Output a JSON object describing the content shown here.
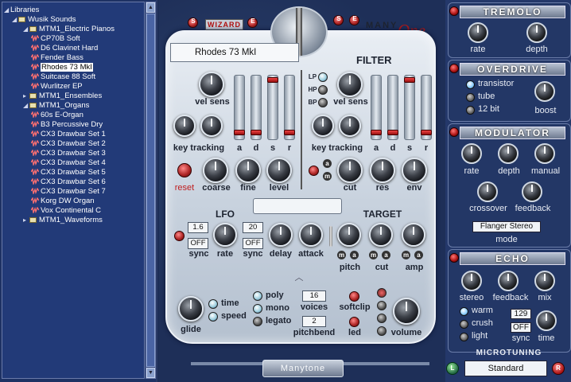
{
  "browser": {
    "items": [
      {
        "label": "Libraries",
        "level": 0,
        "type": "root"
      },
      {
        "label": "Wusik Sounds",
        "level": 1,
        "type": "folder"
      },
      {
        "label": "MTM1_Electric Pianos",
        "level": 2,
        "type": "folder"
      },
      {
        "label": "CP70B Soft",
        "level": 3,
        "type": "patch"
      },
      {
        "label": "D6 Clavinet Hard",
        "level": 3,
        "type": "patch"
      },
      {
        "label": "Fender Bass",
        "level": 3,
        "type": "patch"
      },
      {
        "label": "Rhodes 73 MkI",
        "level": 3,
        "type": "patch",
        "selected": true
      },
      {
        "label": "Suitcase 88 Soft",
        "level": 3,
        "type": "patch"
      },
      {
        "label": "Wurlitzer EP",
        "level": 3,
        "type": "patch"
      },
      {
        "label": "MTM1_Ensembles",
        "level": 2,
        "type": "folder",
        "collapsed": true
      },
      {
        "label": "MTM1_Organs",
        "level": 2,
        "type": "folder"
      },
      {
        "label": "60s E-Organ",
        "level": 3,
        "type": "patch"
      },
      {
        "label": "B3 Percussive Dry",
        "level": 3,
        "type": "patch"
      },
      {
        "label": "CX3 Drawbar Set 1",
        "level": 3,
        "type": "patch"
      },
      {
        "label": "CX3 Drawbar Set 2",
        "level": 3,
        "type": "patch"
      },
      {
        "label": "CX3 Drawbar Set 3",
        "level": 3,
        "type": "patch"
      },
      {
        "label": "CX3 Drawbar Set 4",
        "level": 3,
        "type": "patch"
      },
      {
        "label": "CX3 Drawbar Set 5",
        "level": 3,
        "type": "patch"
      },
      {
        "label": "CX3 Drawbar Set 6",
        "level": 3,
        "type": "patch"
      },
      {
        "label": "CX3 Drawbar Set 7",
        "level": 3,
        "type": "patch"
      },
      {
        "label": "Korg DW Organ",
        "level": 3,
        "type": "patch"
      },
      {
        "label": "Vox Continental C",
        "level": 3,
        "type": "patch"
      },
      {
        "label": "MTM1_Waveforms",
        "level": 2,
        "type": "folder",
        "collapsed": true
      }
    ]
  },
  "header": {
    "wizard_label": "WIZARD",
    "left_btn1": "S",
    "left_btn2": "E",
    "right_btn1": "S",
    "right_btn2": "E",
    "logo_many": "MANY",
    "logo_one": "One",
    "patch_name": "Rhodes 73 MkI",
    "filter_title": "FILTER"
  },
  "amp": {
    "vel_sens": "vel sens",
    "key_tracking": "key tracking",
    "reset": "reset",
    "coarse": "coarse",
    "fine": "fine",
    "level": "level",
    "adsr": [
      "a",
      "d",
      "s",
      "r"
    ]
  },
  "filter": {
    "modes": [
      "LP",
      "HP",
      "BP"
    ],
    "vel_sens": "vel sens",
    "key_tracking": "key tracking",
    "cut": "cut",
    "res": "res",
    "env": "env",
    "adsr": [
      "a",
      "d",
      "s",
      "r"
    ],
    "ma": [
      "a",
      "m"
    ]
  },
  "lfo": {
    "title": "LFO",
    "value1": "1.6",
    "value2": "20",
    "off1": "OFF",
    "off2": "OFF",
    "sync1": "sync",
    "rate": "rate",
    "sync2": "sync",
    "delay": "delay",
    "attack": "attack"
  },
  "target": {
    "title": "TARGET",
    "pitch": "pitch",
    "cut": "cut",
    "amp": "amp",
    "ma": [
      "m",
      "a"
    ]
  },
  "bottom": {
    "glide": "glide",
    "time": "time",
    "speed": "speed",
    "poly": "poly",
    "mono": "mono",
    "legato": "legato",
    "voices_val": "16",
    "voices": "voices",
    "pitchbend_val": "2",
    "pitchbend": "pitchbend",
    "softclip": "softclip",
    "led": "led",
    "volume": "volume",
    "brand": "Manytone"
  },
  "tremolo": {
    "title": "TREMOLO",
    "rate": "rate",
    "depth": "depth"
  },
  "overdrive": {
    "title": "OVERDRIVE",
    "opts": [
      "transistor",
      "tube",
      "12 bit"
    ],
    "selected": "transistor",
    "boost": "boost"
  },
  "modulator": {
    "title": "MODULATOR",
    "rate": "rate",
    "depth": "depth",
    "manual": "manual",
    "crossover": "crossover",
    "feedback": "feedback",
    "mode_value": "Flanger Stereo",
    "mode": "mode"
  },
  "echo": {
    "title": "ECHO",
    "stereo": "stereo",
    "feedback": "feedback",
    "mix": "mix",
    "opts": [
      "warm",
      "crush",
      "light"
    ],
    "selected": "warm",
    "time_val": "129",
    "off": "OFF",
    "sync": "sync",
    "time": "time"
  },
  "microtuning": {
    "title": "MICROTUNING",
    "value": "Standard",
    "l": "L",
    "r": "R"
  },
  "colors": {
    "accent_red": "#c62828",
    "panel": "#d7dee8",
    "bg": "#1d2e57"
  }
}
